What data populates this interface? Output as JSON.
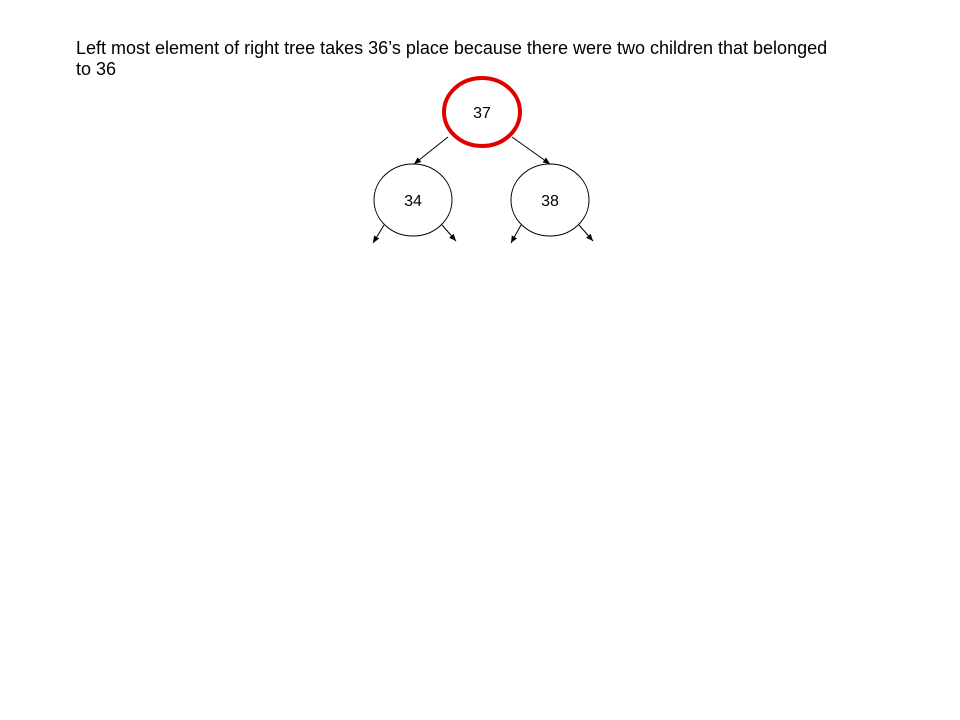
{
  "caption": "Left most element of right tree takes 36’s place because there were two children that belonged to 36",
  "tree": {
    "root": {
      "label": "37",
      "highlight_color": "#e00000"
    },
    "left_child": {
      "label": "34"
    },
    "right_child": {
      "label": "38"
    }
  }
}
